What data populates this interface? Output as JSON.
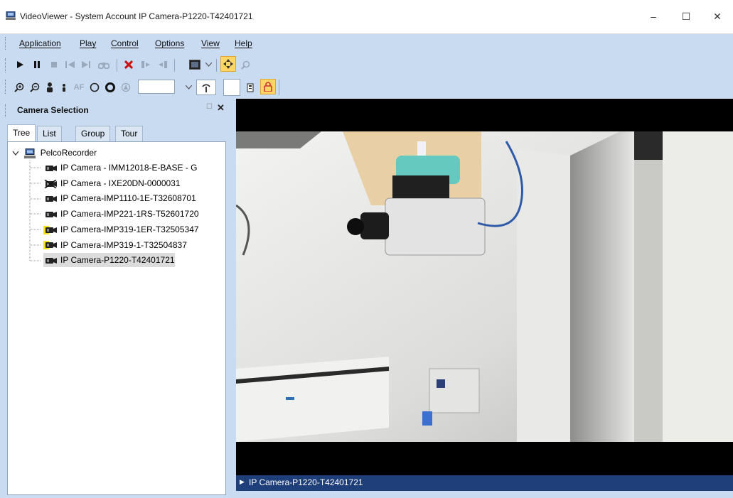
{
  "window": {
    "title": "VideoViewer - System Account IP Camera-P1220-T42401721",
    "minimize": "–",
    "maximize": "☐",
    "close": "✕"
  },
  "menu": [
    "Application",
    "Play",
    "Control",
    "Options",
    "View",
    "Help"
  ],
  "toolbar_icons": {
    "row1": [
      "play-icon",
      "pause-icon",
      "stop-icon",
      "step-back-icon",
      "step-forward-icon",
      "binoculars-icon",
      "delete-icon",
      "export-icon",
      "import-icon",
      "screen-icon",
      "dropdown-icon",
      "pan-tilt-icon",
      "search-icon"
    ],
    "row2": [
      "zoom-in-icon",
      "zoom-out-icon",
      "person-icon",
      "person-small-icon",
      "autofocus-icon",
      "circle-outline-icon",
      "circle-filled-icon",
      "preset-icon",
      "dropdown-icon",
      "antenna-icon",
      "blank-field",
      "tour-icon",
      "lock-icon"
    ]
  },
  "toolbar_text": {
    "autofocus": "AF"
  },
  "camera_panel": {
    "title": "Camera Selection",
    "tabs": [
      "Tree",
      "List",
      "Group",
      "Tour"
    ],
    "active_tab": "Tree",
    "root": "PelcoRecorder",
    "cameras": [
      {
        "label": "IP Camera - IMM12018-E-BASE - G",
        "status": "online"
      },
      {
        "label": "IP Camera - IXE20DN-0000031",
        "status": "offline"
      },
      {
        "label": "IP Camera-IMP1110-1E-T32608701",
        "status": "online"
      },
      {
        "label": "IP Camera-IMP221-1RS-T52601720",
        "status": "online"
      },
      {
        "label": "IP Camera-IMP319-1ER-T32505347",
        "status": "warning"
      },
      {
        "label": "IP Camera-IMP319-1-T32504837",
        "status": "warning"
      },
      {
        "label": "IP Camera-P1220-T42401721",
        "status": "selected"
      }
    ]
  },
  "video": {
    "footer_label": "IP Camera-P1220-T42401721"
  },
  "colors": {
    "chrome": "#c8dbf1",
    "footer": "#1e3f7a",
    "selected_row": "#dcdcdc"
  }
}
